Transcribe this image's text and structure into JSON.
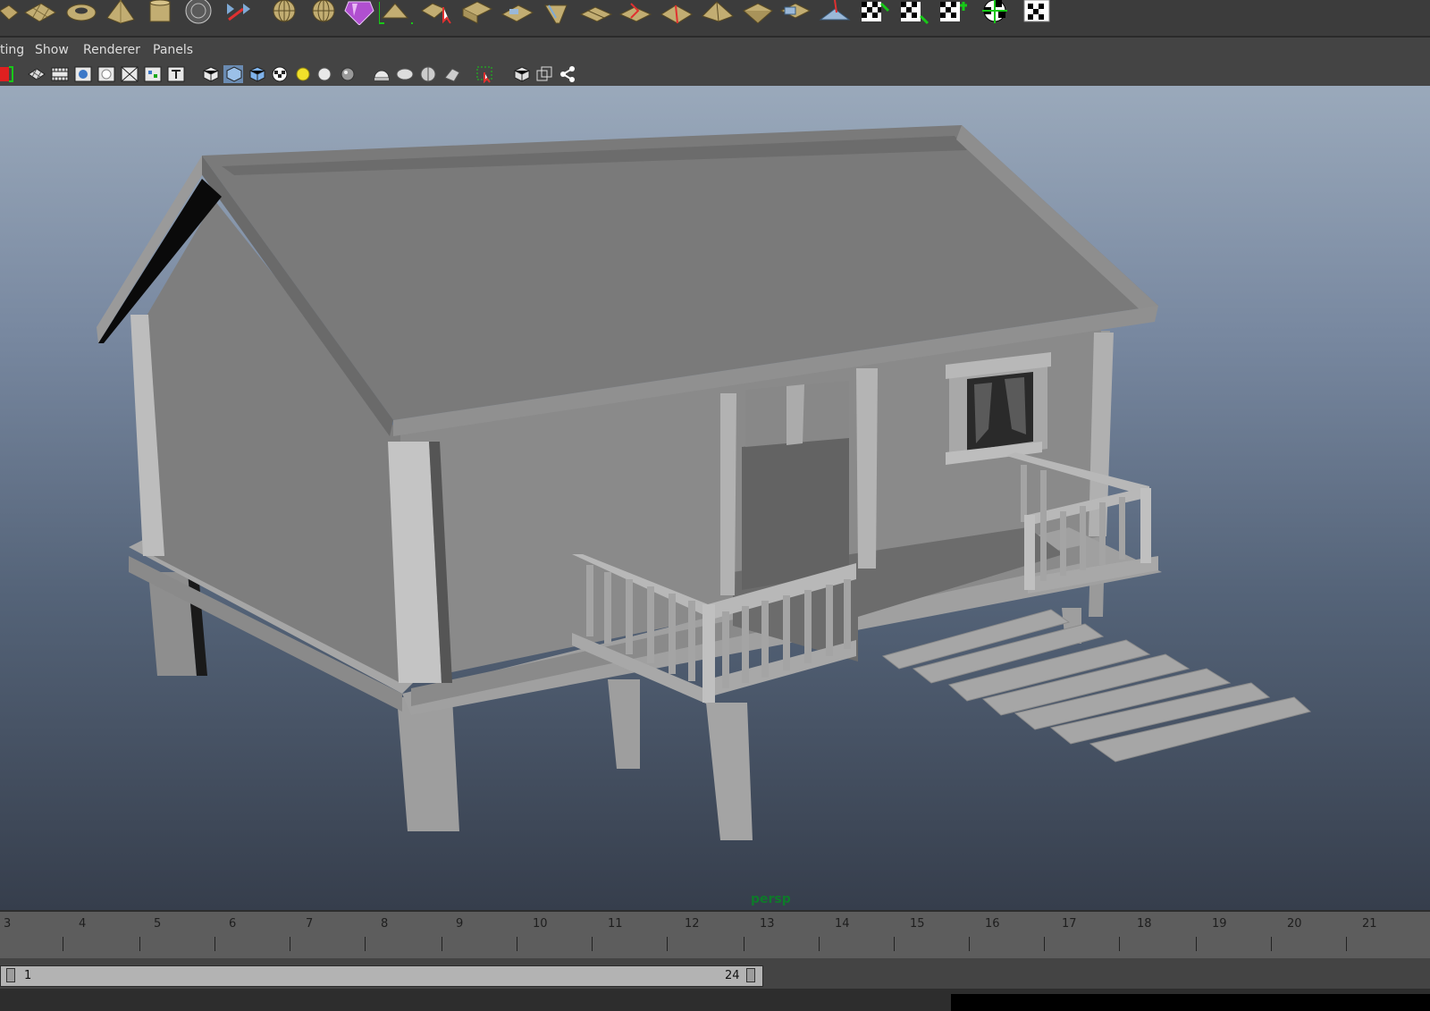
{
  "menu": {
    "items": [
      "ting",
      "Show",
      "Renderer",
      "Panels"
    ]
  },
  "shelf": {
    "icons": [
      "poly-plane-icon",
      "poly-torus-icon",
      "poly-pyramid-icon",
      "poly-cylinder-icon",
      "sculpt-sphere-icon",
      "move-uv-icon",
      "nurbs-sphere-icon",
      "nurbs-sphere-icon",
      "shader-ball-icon",
      "uv-shell-icon",
      "uv-select-icon",
      "uv-plane-icon",
      "uv-cut-icon",
      "uv-cylinder-icon",
      "uv-flatten-icon",
      "uv-fold-icon",
      "uv-sew-icon",
      "uv-split-icon",
      "uv-cone-icon",
      "uv-stack-icon",
      "uv-scale-icon",
      "paint-icon",
      "checker-move-icon",
      "checker-rotate-icon",
      "checker-scale-icon",
      "checker-sphere-icon",
      "checker-flag-icon"
    ]
  },
  "toolbar": {
    "icons": [
      "select-camera-icon",
      "grid-icon",
      "film-gate-icon",
      "wireframe-icon",
      "smooth-shade-icon",
      "wireframe-on-shaded-icon",
      "xray-icon",
      "texture-icon",
      "type-icon",
      "bounding-box-icon",
      "shaded-cube-icon",
      "textured-cube-icon",
      "checker-icon",
      "default-light-icon",
      "all-lights-icon",
      "shadow-icon",
      "hemisphere-icon",
      "soft-icon",
      "ambient-icon",
      "depth-icon",
      "isolate-select-icon",
      "wire-cube-icon",
      "double-cube-icon",
      "share-icon"
    ]
  },
  "viewport": {
    "camera_label": "persp"
  },
  "timeline": {
    "labels": [
      "3",
      "4",
      "5",
      "6",
      "7",
      "8",
      "9",
      "10",
      "11",
      "12",
      "13",
      "14",
      "15",
      "16",
      "17",
      "18",
      "19",
      "20",
      "21"
    ]
  },
  "range": {
    "start": "1",
    "end": "24"
  },
  "colors": {
    "camera_label": "#0e7a2a",
    "viewport_top": "#9aa9bb",
    "viewport_bottom": "#363e4c"
  }
}
